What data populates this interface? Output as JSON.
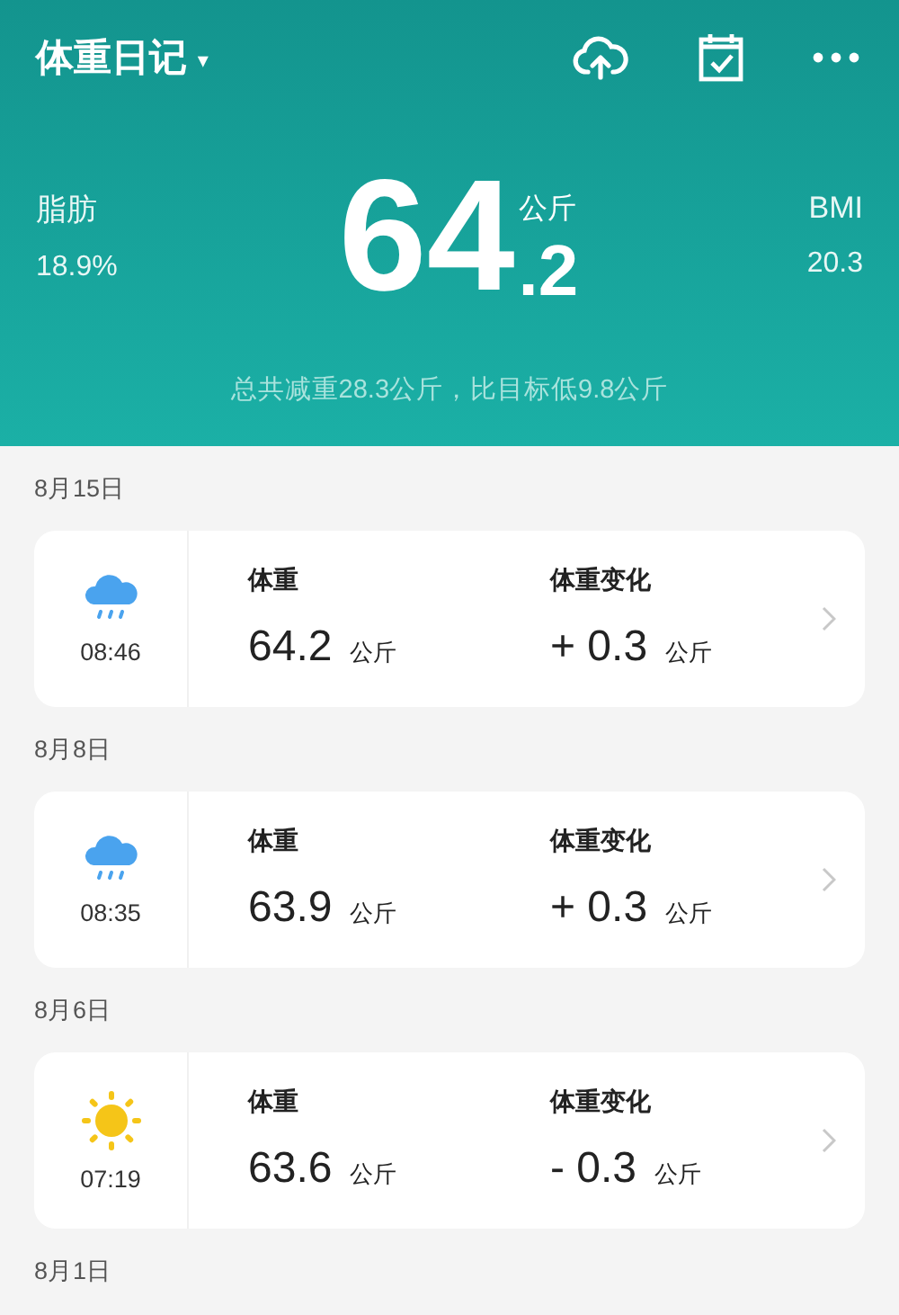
{
  "header": {
    "title": "体重日记",
    "dropdown_icon": "▾"
  },
  "summary": {
    "left_label": "脂肪",
    "left_value": "18.9%",
    "weight_int": "64",
    "weight_dec": ".2",
    "weight_unit": "公斤",
    "right_label": "BMI",
    "right_value": "20.3",
    "note": "总共减重28.3公斤，比目标低9.8公斤"
  },
  "entries": [
    {
      "date": "8月15日",
      "kind": "rain",
      "time": "08:46",
      "weight_label": "体重",
      "weight": "64.2",
      "weight_unit": "公斤",
      "change_label": "体重变化",
      "change": "+ 0.3",
      "change_unit": "公斤"
    },
    {
      "date": "8月8日",
      "kind": "rain",
      "time": "08:35",
      "weight_label": "体重",
      "weight": "63.9",
      "weight_unit": "公斤",
      "change_label": "体重变化",
      "change": "+ 0.3",
      "change_unit": "公斤"
    },
    {
      "date": "8月6日",
      "kind": "sun",
      "time": "07:19",
      "weight_label": "体重",
      "weight": "63.6",
      "weight_unit": "公斤",
      "change_label": "体重变化",
      "change": "- 0.3",
      "change_unit": "公斤"
    }
  ],
  "trailing_date": "8月1日"
}
